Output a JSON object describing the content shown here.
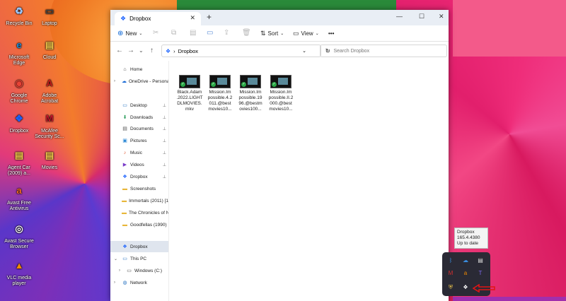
{
  "desktop": {
    "icons": [
      {
        "label": "Recycle Bin",
        "glyph": "♻",
        "color": "#9ec9ff"
      },
      {
        "label": "Laptop",
        "glyph": "▭",
        "color": "#444444"
      },
      {
        "label": "Microsoft Edge",
        "glyph": "e",
        "color": "#1c8cd6"
      },
      {
        "label": "Cloud",
        "glyph": "▤",
        "color": "#f2c94c"
      },
      {
        "label": "Google Chrome",
        "glyph": "◉",
        "color": "#e94235"
      },
      {
        "label": "Adobe Acrobat",
        "glyph": "A",
        "color": "#c41b1b"
      },
      {
        "label": "Dropbox",
        "glyph": "❖",
        "color": "#1a62ff"
      },
      {
        "label": "McAfee Security Sc...",
        "glyph": "M",
        "color": "#c4142b"
      },
      {
        "label": "Agent Car (2009) a...",
        "glyph": "▤",
        "color": "#f2c94c"
      },
      {
        "label": "Movies",
        "glyph": "▤",
        "color": "#f2c94c"
      },
      {
        "label": "Avast Free Antivirus",
        "glyph": "a",
        "color": "#f26b1d"
      },
      {
        "label": "Avast Secure Browser",
        "glyph": "◎",
        "color": "#f5f5f5"
      },
      {
        "label": "VLC media player",
        "glyph": "▲",
        "color": "#f28a00"
      }
    ]
  },
  "window": {
    "tab_title": "Dropbox",
    "new_tab": "+",
    "controls": {
      "minimize": "—",
      "maximize": "☐",
      "close": "✕"
    },
    "toolbar": {
      "new_label": "New",
      "sort_label": "Sort",
      "view_label": "View",
      "more_label": "•••"
    },
    "address": {
      "path_label": "Dropbox",
      "separator": "›"
    },
    "search": {
      "placeholder": "Search Dropbox"
    },
    "sidebar": {
      "items": [
        {
          "label": "Home",
          "icon": "⌂",
          "icon_color": "#444"
        },
        {
          "label": "OneDrive - Personal",
          "icon": "☁",
          "icon_color": "#1c6cd6"
        },
        {
          "label": "Desktop",
          "icon": "▭",
          "icon_color": "#2f78c4"
        },
        {
          "label": "Downloads",
          "icon": "⬇",
          "icon_color": "#2a9d5b"
        },
        {
          "label": "Documents",
          "icon": "▤",
          "icon_color": "#555"
        },
        {
          "label": "Pictures",
          "icon": "▣",
          "icon_color": "#2f8ad6"
        },
        {
          "label": "Music",
          "icon": "♪",
          "icon_color": "#e0552d"
        },
        {
          "label": "Videos",
          "icon": "▶",
          "icon_color": "#7a3cc9"
        },
        {
          "label": "Dropbox",
          "icon": "❖",
          "icon_color": "#1a62ff"
        },
        {
          "label": "Screenshots",
          "icon": "▬",
          "icon_color": "#e8b73a"
        },
        {
          "label": "Immortals (2011) [1",
          "icon": "▬",
          "icon_color": "#e8b73a"
        },
        {
          "label": "The Chronicles of N",
          "icon": "▬",
          "icon_color": "#e8b73a"
        },
        {
          "label": "Goodfellas (1990)",
          "icon": "▬",
          "icon_color": "#e8b73a"
        },
        {
          "label": "Dropbox",
          "icon": "❖",
          "icon_color": "#1a62ff"
        },
        {
          "label": "This PC",
          "icon": "▭",
          "icon_color": "#2f78c4"
        },
        {
          "label": "Windows (C:)",
          "icon": "▭",
          "icon_color": "#555"
        },
        {
          "label": "Network",
          "icon": "◍",
          "icon_color": "#2f78c4"
        }
      ],
      "pin_glyph": "📌"
    },
    "files": [
      {
        "lines": [
          "Black.Adam",
          ".2022.LIGHT",
          "DLMOVIES.",
          "mkv"
        ]
      },
      {
        "lines": [
          "Mission.Im",
          "possible.4.2",
          "011.@best",
          "movies10..."
        ]
      },
      {
        "lines": [
          "Mission.Im",
          "possible.19",
          "96.@bestm",
          "ovies100..."
        ]
      },
      {
        "lines": [
          "Mission.Im",
          "possible.II.2",
          "000.@best",
          "movies10..."
        ]
      }
    ]
  },
  "tray": {
    "tooltip": {
      "line1": "Dropbox",
      "line2": "165.4.4380",
      "line3": "Up to date"
    },
    "icons": [
      {
        "name": "bluetooth-icon",
        "glyph": "ᛒ",
        "color": "#3a8de0"
      },
      {
        "name": "onedrive-icon",
        "glyph": "☁",
        "color": "#3a8de0"
      },
      {
        "name": "display-icon",
        "glyph": "▤",
        "color": "#dddddd"
      },
      {
        "name": "mcafee-icon",
        "glyph": "M",
        "color": "#d32f2f"
      },
      {
        "name": "avast-icon",
        "glyph": "a",
        "color": "#f28a00"
      },
      {
        "name": "teams-icon",
        "glyph": "T",
        "color": "#7b68ee"
      },
      {
        "name": "security-icon",
        "glyph": "⛨",
        "color": "#f2c94c"
      },
      {
        "name": "dropbox-icon",
        "glyph": "❖",
        "color": "#ffffff"
      }
    ]
  }
}
